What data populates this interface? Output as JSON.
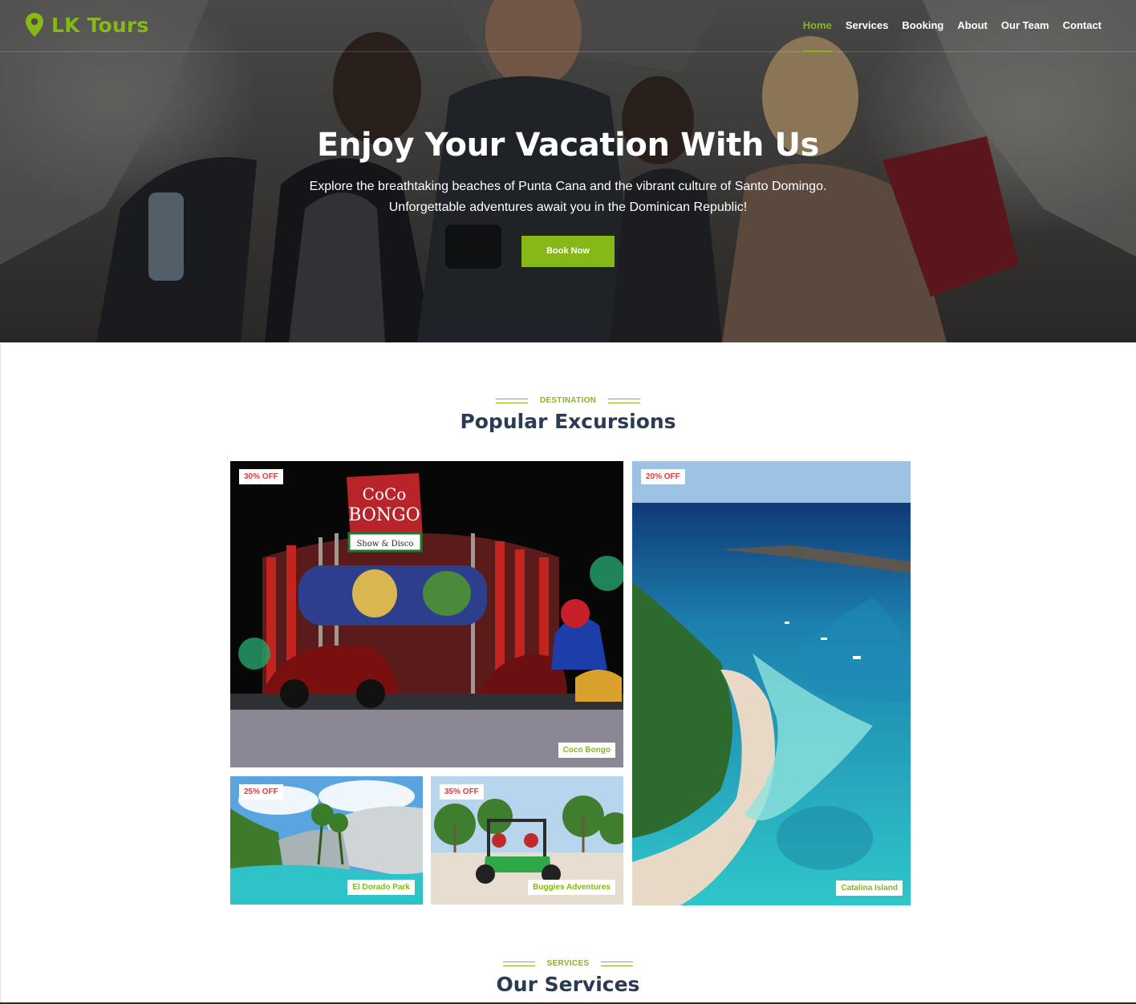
{
  "brand": {
    "name": "LK Tours",
    "color": "#86b817"
  },
  "nav": {
    "items": [
      {
        "label": "Home",
        "active": true
      },
      {
        "label": "Services"
      },
      {
        "label": "Booking"
      },
      {
        "label": "About"
      },
      {
        "label": "Our Team"
      },
      {
        "label": "Contact"
      }
    ]
  },
  "hero": {
    "title": "Enjoy Your Vacation With Us",
    "subtitle_line1": "Explore the breathtaking beaches of Punta Cana and the vibrant culture of Santo Domingo.",
    "subtitle_line2": "Unforgettable adventures await you in the Dominican Republic!",
    "cta": "Book Now"
  },
  "destinations": {
    "kicker": "DESTINATION",
    "title": "Popular Excursions",
    "cards": [
      {
        "discount": "30% OFF",
        "name": "Coco Bongo",
        "sign": "CoCo BONGO",
        "sign_sub": "Show & Disco"
      },
      {
        "discount": "20% OFF",
        "name": "Catalina Island"
      },
      {
        "discount": "25% OFF",
        "name": "El Dorado Park"
      },
      {
        "discount": "35% OFF",
        "name": "Buggies Adventures"
      }
    ]
  },
  "services": {
    "kicker": "SERVICES",
    "title": "Our Services"
  },
  "colors": {
    "accent": "#86b817",
    "discount": "#e03a3a",
    "heading": "#2b3a55"
  }
}
